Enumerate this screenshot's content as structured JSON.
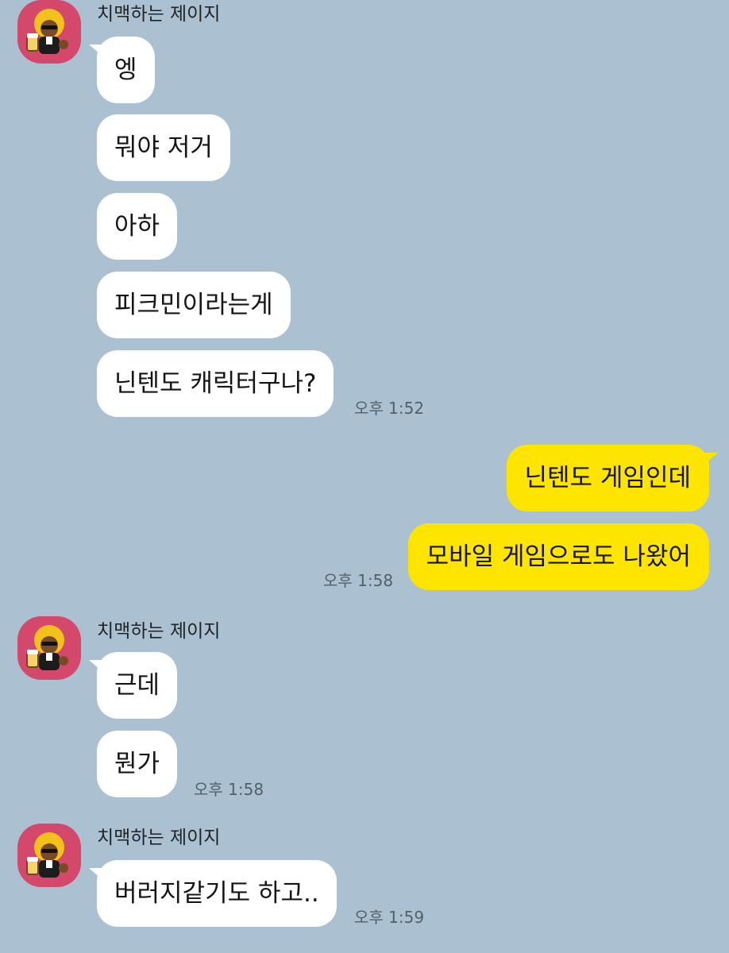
{
  "colors": {
    "background": "#abc1d1",
    "incoming_bubble": "#ffffff",
    "outgoing_bubble": "#fee500",
    "avatar_bg": "#d3486b"
  },
  "groups": [
    {
      "sender": "치맥하는 제이지",
      "avatar_icon": "character-with-beer-icon",
      "messages": [
        "엥",
        "뭐야 저거",
        "아하",
        "피크민이라는게",
        "닌텐도 캐릭터구나?"
      ],
      "time": "오후 1:52"
    },
    {
      "sender": "me",
      "messages": [
        "닌텐도 게임인데",
        "모바일 게임으로도 나왔어"
      ],
      "time": "오후 1:58"
    },
    {
      "sender": "치맥하는 제이지",
      "avatar_icon": "character-with-beer-icon",
      "messages": [
        "근데",
        "뭔가"
      ],
      "time": "오후 1:58"
    },
    {
      "sender": "치맥하는 제이지",
      "avatar_icon": "character-with-beer-icon",
      "messages": [
        "버러지같기도 하고.."
      ],
      "time": "오후 1:59"
    }
  ]
}
